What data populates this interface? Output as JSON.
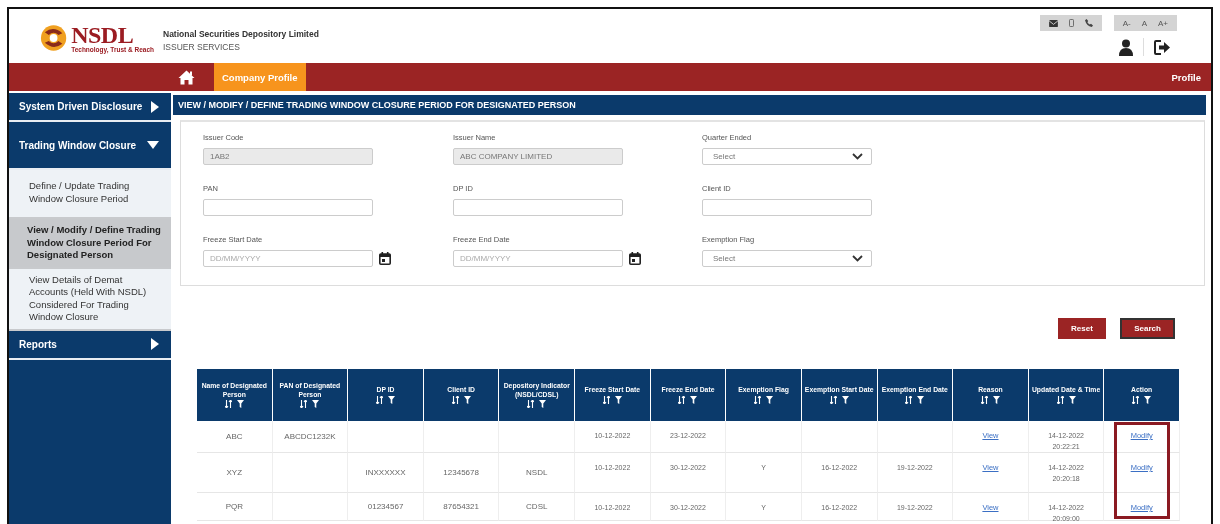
{
  "header": {
    "logo": {
      "name": "NSDL",
      "tagline": "Technology, Trust & Reach"
    },
    "org_name": "National Securities Depository Limited",
    "service": "ISSUER SERVICES",
    "font_sizes": [
      "A-",
      "A",
      "A+"
    ]
  },
  "nav": {
    "tabs": [
      {
        "label": "Company Profile",
        "selected": true
      }
    ],
    "right_link": "Profile"
  },
  "sidebar": {
    "items": [
      {
        "label": "System Driven Disclosure",
        "kind": "section",
        "expanded": false
      },
      {
        "label": "Trading Window Closure",
        "kind": "section",
        "expanded": true,
        "children": [
          {
            "label": "Define / Update Trading Window Closure Period",
            "selected": false
          },
          {
            "label": "View / Modify / Define Trading Window Closure Period For Designated Person",
            "selected": true
          },
          {
            "label": "View Details of Demat Accounts (Held With NSDL) Considered For Trading Window Closure",
            "selected": false
          }
        ]
      },
      {
        "label": "Reports",
        "kind": "section",
        "expanded": false
      }
    ]
  },
  "page_title": "VIEW / MODIFY / DEFINE TRADING WINDOW CLOSURE PERIOD FOR DESIGNATED PERSON",
  "form": {
    "fields": [
      {
        "label": "Issuer Code",
        "kind": "text",
        "value": "1AB2",
        "disabled": true
      },
      {
        "label": "Issuer Name",
        "kind": "text",
        "value": "ABC COMPANY LIMITED",
        "disabled": true
      },
      {
        "label": "Quarter Ended",
        "kind": "select",
        "value": "Select",
        "disabled": false
      },
      {
        "label": "PAN",
        "kind": "text",
        "disabled": false
      },
      {
        "label": "DP ID",
        "kind": "text",
        "disabled": false
      },
      {
        "label": "Client ID",
        "kind": "text",
        "disabled": false
      },
      {
        "label": "Freeze Start Date",
        "kind": "date",
        "placeholder": "DD/MM/YYYY",
        "disabled": false
      },
      {
        "label": "Freeze End Date",
        "kind": "date",
        "placeholder": "DD/MM/YYYY",
        "disabled": false
      },
      {
        "label": "Exemption Flag",
        "kind": "select",
        "value": "Select",
        "disabled": false
      }
    ],
    "buttons": [
      {
        "label": "Reset",
        "focused": false
      },
      {
        "label": "Search",
        "focused": true
      }
    ]
  },
  "table": {
    "columns": [
      {
        "label": "Name of Designated Person",
        "kind": "text",
        "highlighted": false
      },
      {
        "label": "PAN of Designated Person",
        "kind": "text",
        "highlighted": false
      },
      {
        "label": "DP ID",
        "kind": "text",
        "highlighted": false
      },
      {
        "label": "Client ID",
        "kind": "text",
        "highlighted": false
      },
      {
        "label": "Depository Indicator (NSDL/CDSL)",
        "kind": "text",
        "highlighted": false
      },
      {
        "label": "Freeze Start Date",
        "kind": "text",
        "highlighted": false
      },
      {
        "label": "Freeze End Date",
        "kind": "text",
        "highlighted": false
      },
      {
        "label": "Exemption Flag",
        "kind": "text",
        "highlighted": false
      },
      {
        "label": "Exemption Start Date",
        "kind": "text",
        "highlighted": false
      },
      {
        "label": "Exemption End Date",
        "kind": "text",
        "highlighted": false
      },
      {
        "label": "Reason",
        "kind": "link",
        "highlighted": false
      },
      {
        "label": "Updated Date & Time",
        "kind": "text",
        "highlighted": false
      },
      {
        "label": "Action",
        "kind": "link",
        "highlighted": true
      }
    ],
    "rows": [
      [
        "ABC",
        "ABCDC1232K",
        null,
        null,
        null,
        "10-12-2022",
        "23-12-2022",
        null,
        null,
        null,
        "View",
        "14-12-2022\n20:22:21",
        "Modify"
      ],
      [
        "XYZ",
        null,
        "INXXXXXX",
        "12345678",
        "NSDL",
        "10-12-2022",
        "30-12-2022",
        "Y",
        "16-12-2022",
        "19-12-2022",
        "View",
        "14-12-2022\n20:20:18",
        "Modify"
      ],
      [
        "PQR",
        null,
        "01234567",
        "87654321",
        "CDSL",
        "10-12-2022",
        "30-12-2022",
        "Y",
        "16-12-2022",
        "19-12-2022",
        "View",
        "14-12-2022\n20:09:00",
        "Modify"
      ]
    ]
  }
}
